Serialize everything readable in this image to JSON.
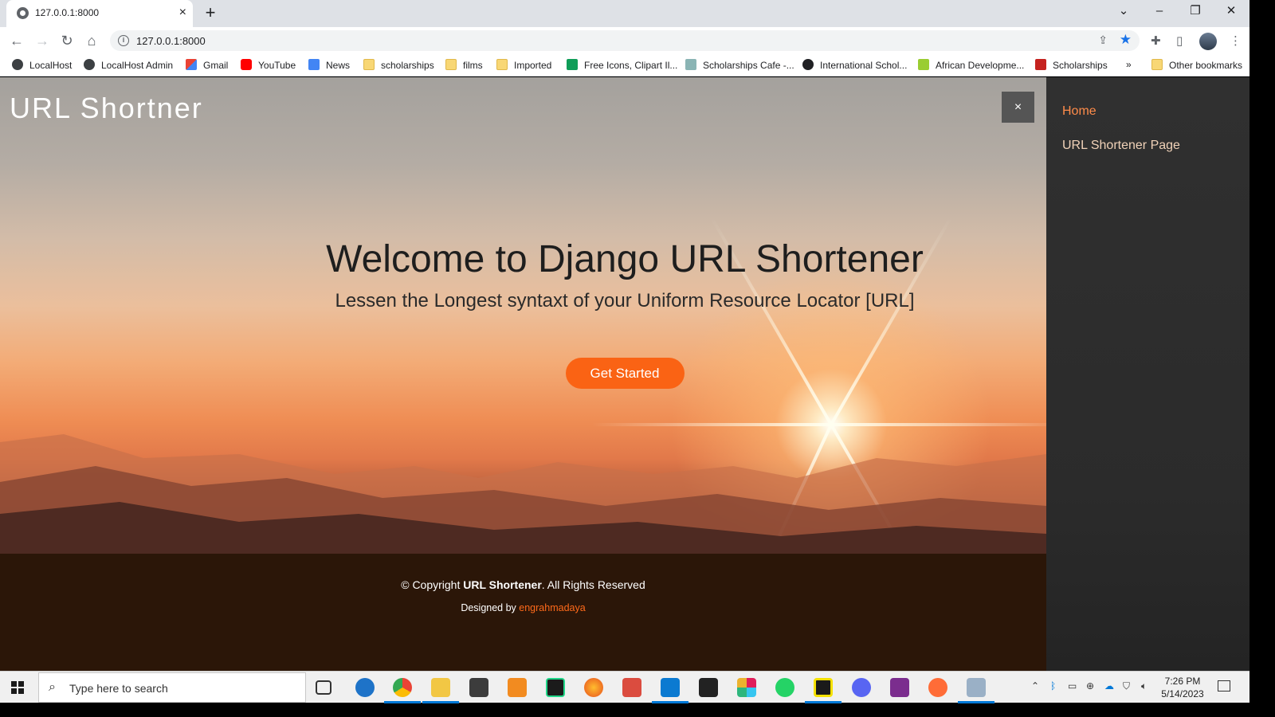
{
  "browser": {
    "tab_title": "127.0.0.1:8000",
    "tab_close": "×",
    "new_tab": "+",
    "url": "127.0.0.1:8000",
    "bookmarks": [
      {
        "label": "LocalHost",
        "icon": "globe-icon"
      },
      {
        "label": "LocalHost Admin",
        "icon": "globe-icon"
      },
      {
        "label": "Gmail",
        "icon": "gmail-icon"
      },
      {
        "label": "YouTube",
        "icon": "youtube-icon"
      },
      {
        "label": "News",
        "icon": "news-icon"
      },
      {
        "label": "scholarships",
        "icon": "folder-icon"
      },
      {
        "label": "films",
        "icon": "folder-icon"
      },
      {
        "label": "Imported",
        "icon": "folder-icon"
      },
      {
        "label": "Free Icons, Clipart Il...",
        "icon": "freeicons-icon"
      },
      {
        "label": "Scholarships Cafe -...",
        "icon": "graduation-cap-icon"
      },
      {
        "label": "International Schol...",
        "icon": "hand-icon"
      },
      {
        "label": "African Developme...",
        "icon": "afdb-icon"
      },
      {
        "label": "Scholarships",
        "icon": "graduation-cap-icon"
      }
    ],
    "more_bookmarks": "»",
    "other_bookmarks": "Other bookmarks"
  },
  "site": {
    "logo": "URL Shortner",
    "close_icon": "×",
    "hero_title": "Welcome to Django URL Shortener",
    "hero_subtitle": "Lessen the Longest syntaxt of your Uniform Resource Locator [URL]",
    "cta_label": "Get Started",
    "nav": [
      {
        "label": "Home",
        "active": true
      },
      {
        "label": "URL Shortener Page",
        "active": false
      }
    ],
    "footer": {
      "copyright_prefix": "© Copyright ",
      "copyright_brand": "URL Shortener",
      "copyright_suffix": ". All Rights Reserved",
      "designed_prefix": "Designed by ",
      "designer": "engrahmadaya"
    },
    "colors": {
      "accent": "#fa6314",
      "footer_bg": "#2b1608",
      "sidenav_bg": "#303030"
    }
  },
  "taskbar": {
    "search_placeholder": "Type here to search",
    "time": "7:26 PM",
    "date": "5/14/2023"
  }
}
